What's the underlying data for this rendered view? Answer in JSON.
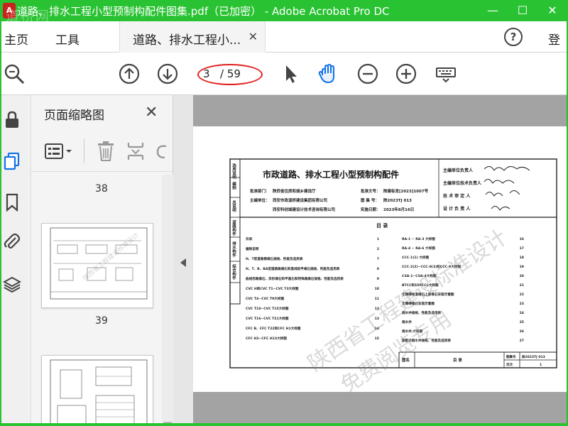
{
  "window": {
    "title": "道路、排水工程小型预制构配件图集.pdf（已加密） - Adobe Acrobat Pro DC",
    "watermark": "道桥网",
    "minimize": "—",
    "maximize": "☐",
    "close": "✕"
  },
  "menu": {
    "home": "主页",
    "tools": "工具",
    "doc_tab": "道路、排水工程小...",
    "doc_tab_close": "✕",
    "help": "?",
    "login": "登"
  },
  "toolbar": {
    "current_page": "3",
    "total_pages": "/ 59",
    "icons": [
      "zoom-icon",
      "page-up-icon",
      "page-down-icon",
      "select-arrow-icon",
      "hand-icon",
      "zoom-out-icon",
      "zoom-in-icon",
      "keyboard-icon"
    ]
  },
  "thumbnails": {
    "title": "页面缩略图",
    "close": "✕",
    "pages": [
      "38",
      "39"
    ]
  },
  "document": {
    "title": "市政道路、排水工程小型预制构配件",
    "side_labels": [
      "选用说明",
      "编制",
      "总说明",
      "道路构件",
      "排水构件",
      "综合构件"
    ],
    "approval_dept_label": "批准部门：",
    "approval_dept": "陕西省住房和城乡建设厅",
    "approval_no_label": "批准文号：",
    "approval_no": "陕建标发[2023]1007号",
    "chief_unit_label": "主编单位：",
    "chief_unit": "西安市政道桥建设集团有限公司",
    "co_unit": "西安科创城建设计技术咨询有限公司",
    "atlas_no_label": "图 集 号：",
    "atlas_no": "陕2023TJ 013",
    "impl_date_label": "实施日期：",
    "impl_date": "2023年8月16日",
    "roles": [
      "主编单位负责人",
      "主编单位技术负责人",
      "技 术 审 定 人",
      "设 计 负 责 人"
    ],
    "toc_title": "目  录",
    "toc_left": [
      "目录",
      "编制说明",
      "H、T型道路侧缘石规格、性能及选用表",
      "H、T、B、BA型道路路缘石和直线段平缘石规格、性能及选用表",
      "曲线形路缘石、异形缘石和平面石和特殊路缘石规格、性能及选用表",
      "CVC H和CVC T1~CVC T3大样图",
      "CVC T4~CVC T9大样图",
      "CVC T10~CVC T15大样图",
      "CVC T16~CVC T21大样图",
      "CFC B、CFC T22和CFC H1大样图",
      "CFC H2~CFC H13大样图"
    ],
    "toc_left_pages": [
      "1",
      "2",
      "7",
      "8",
      "9",
      "10",
      "11",
      "12",
      "13",
      "14",
      "15"
    ],
    "toc_right": [
      "RA-1 ~ RA-3 大样图",
      "RA-4 ~ RA-6 大样图",
      "CCC-1(1) 大样图",
      "CCC-2(2)~CCC-8(3)和CCC-9大样图",
      "CSA-1~CSA-4大样图",
      "BTCC和15PCCC大样图",
      "无障碍坡道缘石上部缘石安装示意图",
      "无障碍缘石安装示意图",
      "雨水井规格、性能及选用表",
      "雨水井",
      "雨水井 大样图",
      "装配式雨水井规格、性能及选用表"
    ],
    "toc_right_pages": [
      "16",
      "17",
      "18",
      "19",
      "20",
      "21",
      "22",
      "23",
      "24",
      "25",
      "26",
      "27"
    ],
    "footer_label": "图名",
    "footer_name": "目  录",
    "footer_atlas_label": "图集号",
    "footer_atlas": "陕2023TJ 013",
    "footer_page_label": "页次",
    "footer_page": "1",
    "stamp_line1": "陕西省工程建设标准设计",
    "stamp_line2": "免费阅览专用"
  },
  "colors": {
    "titlebar": "#29c232",
    "annotation": "#e0201e",
    "accent_blue": "#1473e6"
  }
}
